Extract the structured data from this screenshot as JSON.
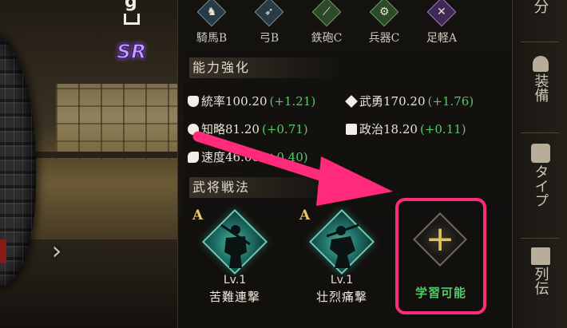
{
  "character": {
    "rarity": "SR",
    "partial_glyph": "g"
  },
  "aptitudes": [
    {
      "icon": "horse-icon",
      "label": "騎馬B",
      "tone": "blue",
      "glyph": "♞"
    },
    {
      "icon": "bow-icon",
      "label": "弓B",
      "tone": "blue",
      "glyph": "➶"
    },
    {
      "icon": "musket-icon",
      "label": "鉄砲C",
      "tone": "green",
      "glyph": "⟋"
    },
    {
      "icon": "cannon-icon",
      "label": "兵器C",
      "tone": "green",
      "glyph": "⚙"
    },
    {
      "icon": "foot-soldier-icon",
      "label": "足軽A",
      "tone": "purple",
      "glyph": "✕"
    }
  ],
  "stats_section": {
    "title": "能力強化",
    "stats": [
      {
        "icon": "leadership-icon",
        "label": "統率",
        "value": "100.20",
        "bonus": "(+1.21)"
      },
      {
        "icon": "valor-icon",
        "label": "武勇",
        "value": "170.20",
        "bonus": "(+1.76)"
      },
      {
        "icon": "intellect-icon",
        "label": "知略",
        "value": "81.20",
        "bonus": "(+0.71)"
      },
      {
        "icon": "politics-icon",
        "label": "政治",
        "value": "18.20",
        "bonus": "(+0.11)"
      },
      {
        "icon": "speed-icon",
        "label": "速度",
        "value": "46.00",
        "bonus": "(+0.40)"
      }
    ]
  },
  "tactics_section": {
    "title": "武将戦法",
    "tactics": [
      {
        "rank": "A",
        "level": "Lv.1",
        "name": "苦難連撃"
      },
      {
        "rank": "A",
        "level": "Lv.1",
        "name": "壮烈痛撃"
      }
    ],
    "learn_slot": {
      "plus": "+",
      "label": "学習可能"
    }
  },
  "rail": {
    "top_label": "分",
    "equip_label": "装備",
    "type_label": "タイプ",
    "bio_label": "列伝"
  },
  "colors": {
    "highlight": "#ff2a7a",
    "bonus_green": "#58c86a",
    "rank_gold": "#e8c56a"
  }
}
